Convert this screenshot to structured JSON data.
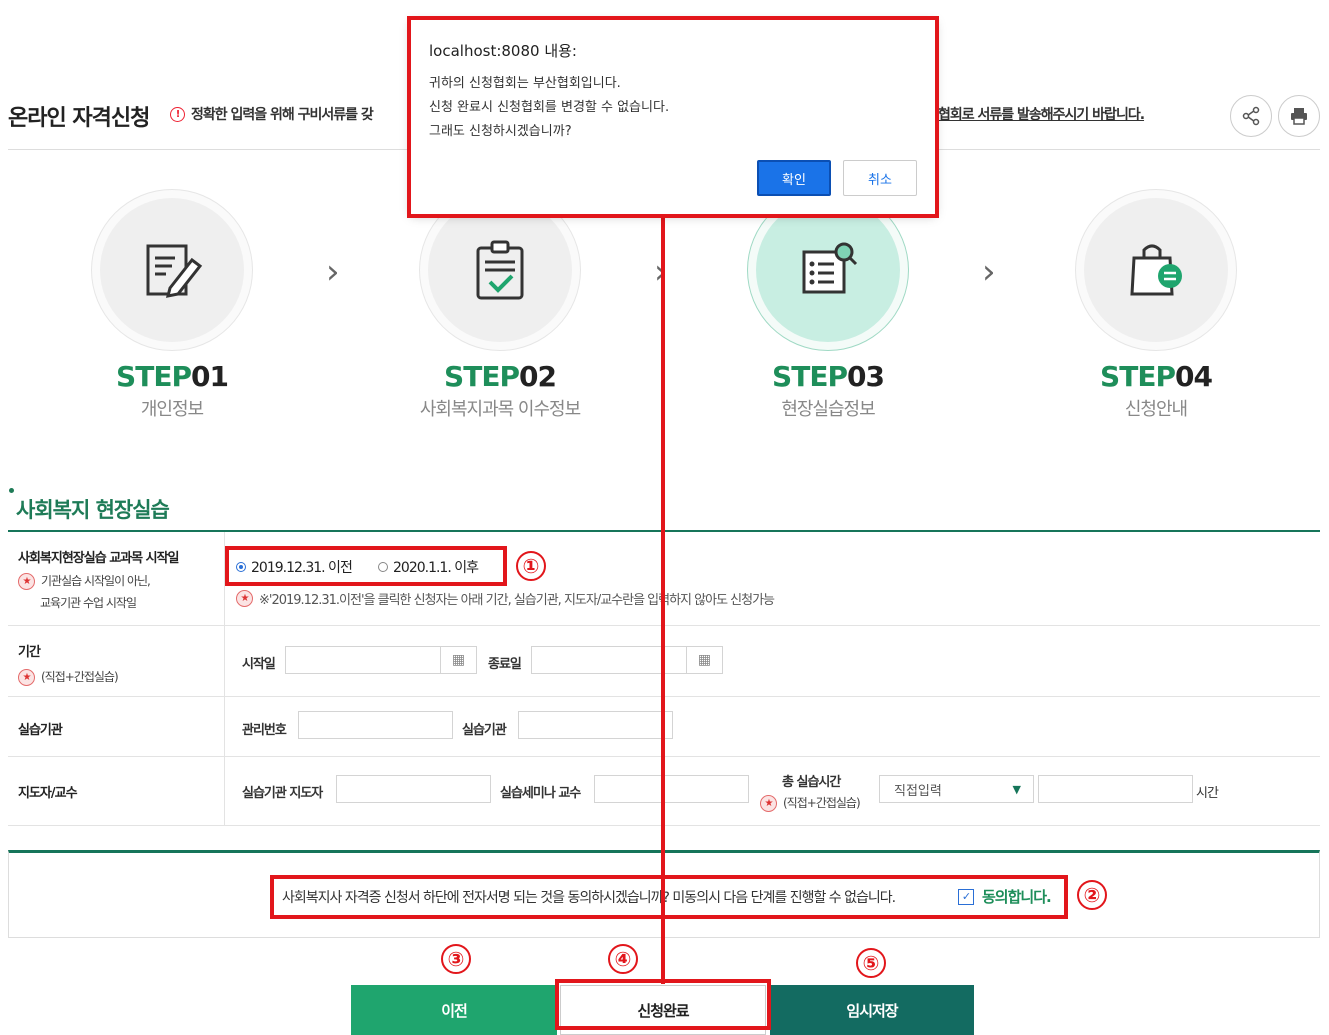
{
  "header": {
    "title": "온라인 자격신청",
    "notice_left": "정확한 입력을 위해 구비서류를 갖",
    "notice_right": "협회로 서류를 발송해주시기 바랍니다."
  },
  "steps": [
    {
      "prefix": "STEP",
      "num": "01",
      "label": "개인정보",
      "icon": "document-pen-icon",
      "active": false
    },
    {
      "prefix": "STEP",
      "num": "02",
      "label": "사회복지과목 이수정보",
      "icon": "clipboard-check-icon",
      "active": false
    },
    {
      "prefix": "STEP",
      "num": "03",
      "label": "현장실습정보",
      "icon": "list-search-icon",
      "active": true
    },
    {
      "prefix": "STEP",
      "num": "04",
      "label": "신청안내",
      "icon": "bag-chat-icon",
      "active": false
    }
  ],
  "section": {
    "title": "사회복지 현장실습"
  },
  "form": {
    "start_date": {
      "label": "사회복지현장실습 교과목 시작일",
      "sub1": "기관실습 시작일이 아닌,",
      "sub2": "교육기관 수업 시작일",
      "option1": "2019.12.31. 이전",
      "option2": "2020.1.1. 이후",
      "selected": "2019.12.31. 이전",
      "hint": "※'2019.12.31.이전'을 클릭한 신청자는 아래 기간, 실습기관, 지도자/교수란을 입력하지 않아도 신청가능"
    },
    "period": {
      "label": "기간",
      "sub": "(직접+간접실습)",
      "start_label": "시작일",
      "end_label": "종료일",
      "start_value": "",
      "end_value": ""
    },
    "institution": {
      "label": "실습기관",
      "mgmt_label": "관리번호",
      "inst_label": "실습기관",
      "mgmt_value": "",
      "inst_value": ""
    },
    "supervisor": {
      "label": "지도자/교수",
      "sup_label": "실습기관 지도자",
      "prof_label": "실습세미나 교수",
      "total_label": "총 실습시간",
      "total_sub": "(직접+간접실습)",
      "select_value": "직접입력",
      "hours_unit": "시간"
    }
  },
  "agreement": {
    "text": "사회복지사 자격증 신청서 하단에 전자서명 되는 것을 동의하시겠습니까? 미동의시 다음 단계를 진행할 수 없습니다.",
    "check_label": "동의합니다.",
    "checked": true
  },
  "buttons": {
    "prev": "이전",
    "done": "신청완료",
    "save": "임시저장"
  },
  "dialog": {
    "title": "localhost:8080 내용:",
    "message": "귀하의 신청협회는 부산협회입니다.\n신청 완료시 신청협회를 변경할 수 없습니다.\n그래도 신청하시겠습니까?",
    "ok": "확인",
    "cancel": "취소"
  },
  "annotations": [
    "①",
    "②",
    "③",
    "④",
    "⑤"
  ],
  "colors": {
    "accent_green": "#1e8e5a",
    "dark_green": "#136b61",
    "annotation_red": "#e2161b",
    "dialog_blue": "#1a73e8"
  }
}
